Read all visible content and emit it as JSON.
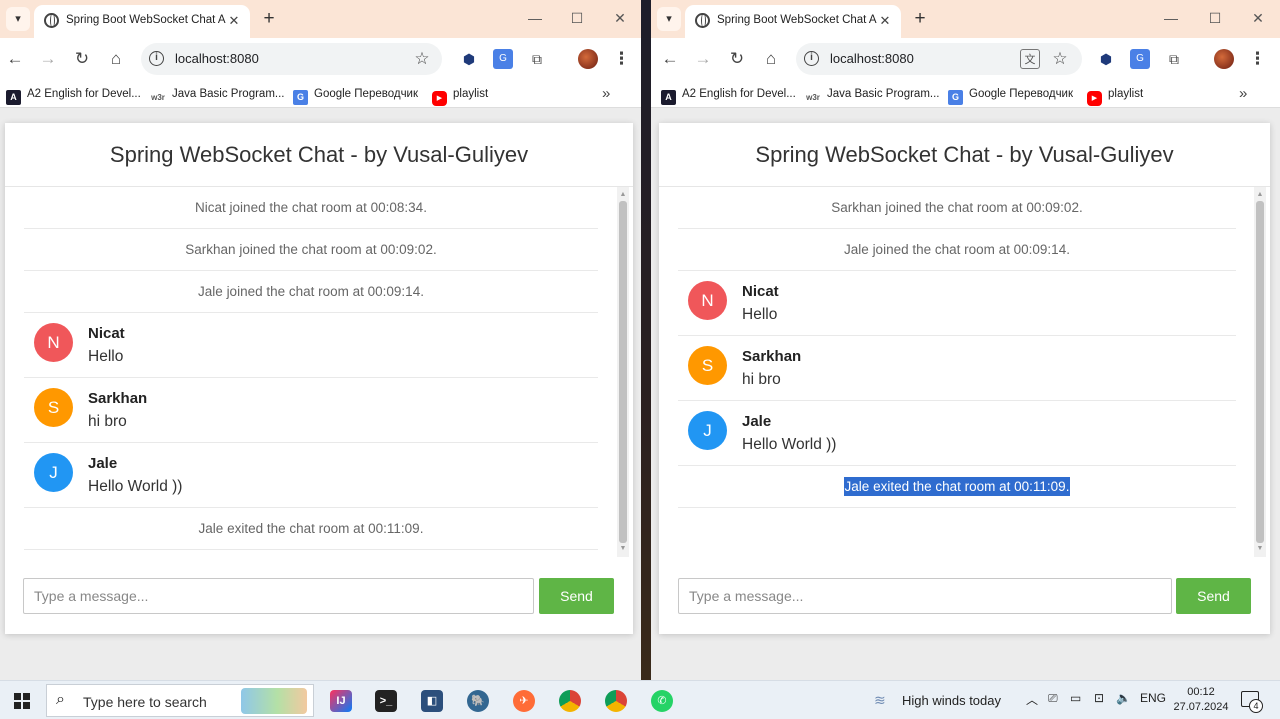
{
  "browser": {
    "tab_title": "Spring Boot WebSocket Chat Ap",
    "url": "localhost:8080",
    "bookmarks": [
      "A2 English for Devel...",
      "Java Basic Program...",
      "Google Переводчик",
      "playlist"
    ],
    "bookmark_icons": {
      "a2": "A",
      "w3": "w3r"
    }
  },
  "chat": {
    "title": "Spring WebSocket Chat - by Vusal-Guliyev",
    "input_placeholder": "Type a message...",
    "send_label": "Send"
  },
  "left_window": {
    "messages": [
      {
        "type": "event",
        "text": "Nicat joined the chat room at 00:08:34."
      },
      {
        "type": "event",
        "text": "Sarkhan joined the chat room at 00:09:02."
      },
      {
        "type": "event",
        "text": "Jale joined the chat room at 00:09:14."
      },
      {
        "type": "chat",
        "initial": "N",
        "sender": "Nicat",
        "text": "Hello",
        "color": "#f0575a"
      },
      {
        "type": "chat",
        "initial": "S",
        "sender": "Sarkhan",
        "text": "hi bro",
        "color": "#ff9800"
      },
      {
        "type": "chat",
        "initial": "J",
        "sender": "Jale",
        "text": "Hello World ))",
        "color": "#2196f3"
      },
      {
        "type": "event",
        "text": "Jale exited the chat room at 00:11:09."
      }
    ]
  },
  "right_window": {
    "messages": [
      {
        "type": "event",
        "text": "Sarkhan joined the chat room at 00:09:02."
      },
      {
        "type": "event",
        "text": "Jale joined the chat room at 00:09:14."
      },
      {
        "type": "chat",
        "initial": "N",
        "sender": "Nicat",
        "text": "Hello",
        "color": "#f0575a"
      },
      {
        "type": "chat",
        "initial": "S",
        "sender": "Sarkhan",
        "text": "hi bro",
        "color": "#ff9800"
      },
      {
        "type": "chat",
        "initial": "J",
        "sender": "Jale",
        "text": "Hello World ))",
        "color": "#2196f3"
      },
      {
        "type": "event",
        "text": "Jale exited the chat room at 00:11:09.",
        "selected": true
      }
    ]
  },
  "taskbar": {
    "search_placeholder": "Type here to search",
    "weather": "High winds today",
    "language": "ENG",
    "time": "00:12",
    "date": "27.07.2024",
    "notification_count": "4"
  }
}
